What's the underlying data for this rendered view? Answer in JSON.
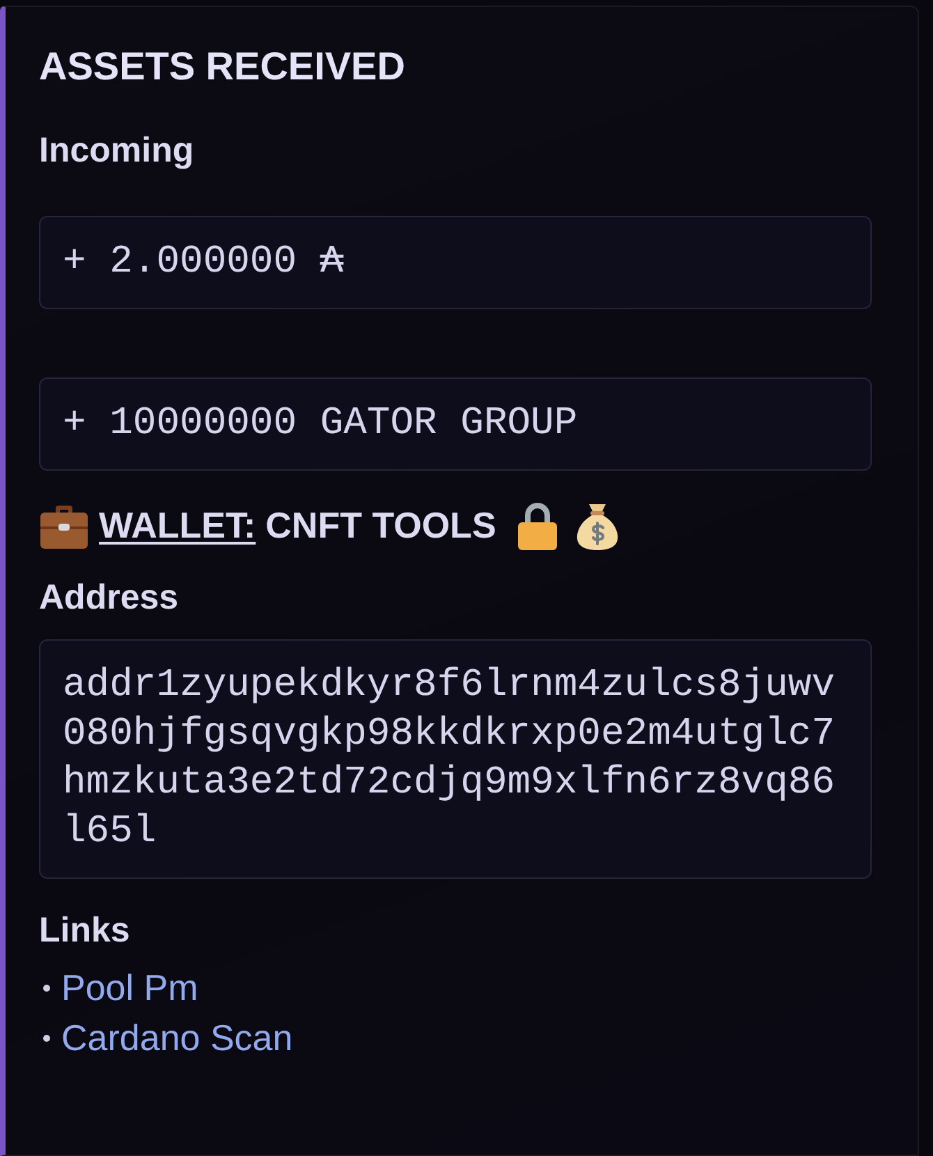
{
  "embed": {
    "title": "ASSETS RECEIVED"
  },
  "incoming": {
    "name": "Incoming",
    "values": [
      "+ 2.000000 ₳",
      "+ 10000000 GATOR GROUP"
    ]
  },
  "wallet": {
    "link_label": "WALLET:",
    "name": "CNFT TOOLS"
  },
  "address": {
    "name": "Address",
    "value": "addr1zyupekdkyr8f6lrnm4zulcs8juwv080hjfgsqvgkp98kkdkrxp0e2m4utglc7hmzkuta3e2td72cdjq9m9xlfn6rz8vq86l65l"
  },
  "links": {
    "name": "Links",
    "items": [
      "Pool Pm",
      "Cardano Scan"
    ]
  }
}
